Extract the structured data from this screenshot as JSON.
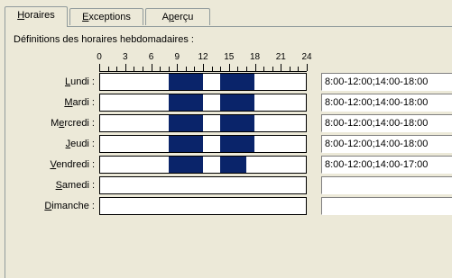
{
  "tabs": [
    {
      "label": "Horaires",
      "accel": "H",
      "rest": "oraires",
      "active": true
    },
    {
      "label": "Exceptions",
      "accel": "E",
      "rest": "xceptions",
      "active": false
    },
    {
      "label": "Aperçu",
      "accel": "p",
      "pre": "A",
      "rest": "erçu",
      "active": false
    }
  ],
  "caption": "Définitions des horaires hebdomadaires :",
  "ruler": {
    "min": 0,
    "max": 24,
    "labels": [
      "0",
      "3",
      "6",
      "9",
      "12",
      "15",
      "18",
      "21",
      "24"
    ]
  },
  "days": [
    {
      "label": "Lundi :",
      "pre": "",
      "accel": "L",
      "rest": "undi :",
      "hours": [
        [
          8,
          12
        ],
        [
          14,
          18
        ]
      ],
      "value": "8:00-12:00;14:00-18:00"
    },
    {
      "label": "Mardi :",
      "pre": "",
      "accel": "M",
      "rest": "ardi :",
      "hours": [
        [
          8,
          12
        ],
        [
          14,
          18
        ]
      ],
      "value": "8:00-12:00;14:00-18:00"
    },
    {
      "label": "Mercredi :",
      "pre": "M",
      "accel": "e",
      "rest": "rcredi :",
      "hours": [
        [
          8,
          12
        ],
        [
          14,
          18
        ]
      ],
      "value": "8:00-12:00;14:00-18:00"
    },
    {
      "label": "Jeudi :",
      "pre": "",
      "accel": "J",
      "rest": "eudi :",
      "hours": [
        [
          8,
          12
        ],
        [
          14,
          18
        ]
      ],
      "value": "8:00-12:00;14:00-18:00"
    },
    {
      "label": "Vendredi :",
      "pre": "",
      "accel": "V",
      "rest": "endredi :",
      "hours": [
        [
          8,
          12
        ],
        [
          14,
          17
        ]
      ],
      "value": "8:00-12:00;14:00-17:00"
    },
    {
      "label": "Samedi :",
      "pre": "",
      "accel": "S",
      "rest": "amedi :",
      "hours": [],
      "value": ""
    },
    {
      "label": "Dimanche :",
      "pre": "",
      "accel": "D",
      "rest": "imanche :",
      "hours": [],
      "value": ""
    }
  ],
  "colors": {
    "schedule_fill": "#0a246a"
  }
}
